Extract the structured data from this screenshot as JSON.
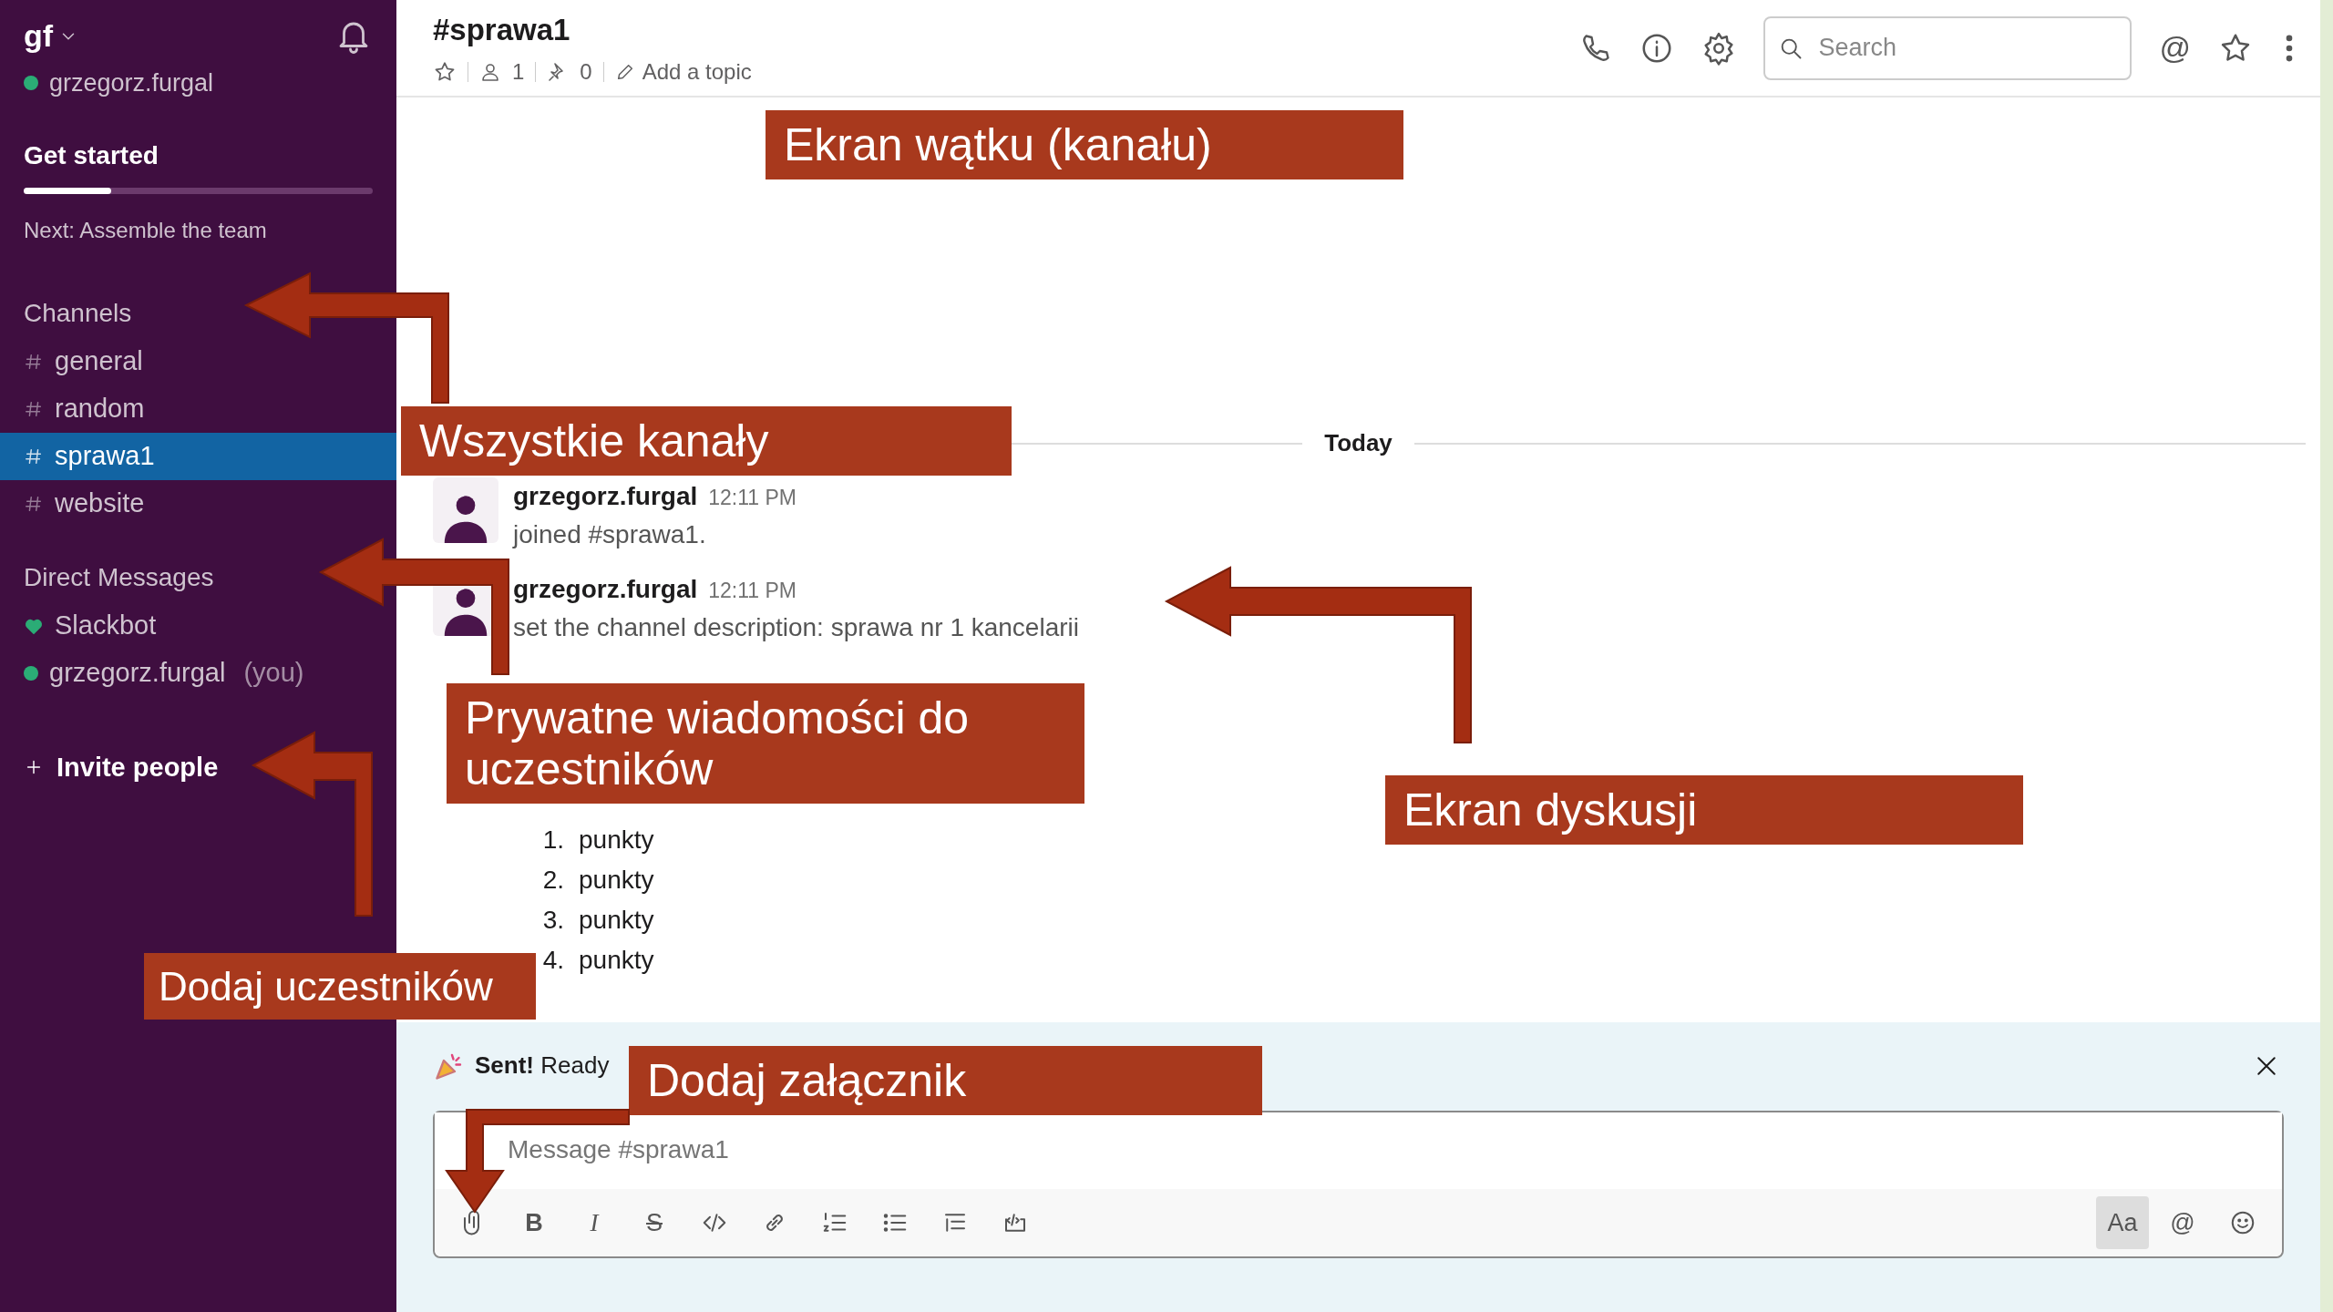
{
  "workspace": {
    "name": "gf",
    "user": "grzegorz.furgal",
    "online": true
  },
  "get_started": {
    "title": "Get started",
    "level": 0.25,
    "next": "Next: Assemble the team"
  },
  "channels": {
    "heading": "Channels",
    "items": [
      {
        "label": "general",
        "selected": false
      },
      {
        "label": "random",
        "selected": false
      },
      {
        "label": "sprawa1",
        "selected": true
      },
      {
        "label": "website",
        "selected": false
      }
    ]
  },
  "direct_messages": {
    "heading": "Direct Messages",
    "items": [
      {
        "kind": "bot",
        "name": "Slackbot"
      },
      {
        "kind": "user",
        "name": "grzegorz.furgal",
        "suffix": "(you)",
        "online": true
      }
    ]
  },
  "invite": {
    "label": "Invite people"
  },
  "channel_header": {
    "title": "#sprawa1",
    "members": "1",
    "pins": "0",
    "topic": "Add a topic"
  },
  "search": {
    "placeholder": "Search"
  },
  "at_label": "@",
  "divider": "Today",
  "messages": [
    {
      "author": "grzegorz.furgal",
      "time": "12:11 PM",
      "text": "joined #sprawa1."
    },
    {
      "author": "grzegorz.furgal",
      "time": "12:11 PM",
      "text": "set the channel description: sprawa nr 1 kancelarii"
    },
    {
      "list": [
        {
          "number": "1.",
          "text": "punkty"
        },
        {
          "number": "2.",
          "text": "punkty"
        },
        {
          "number": "3.",
          "text": "punkty"
        },
        {
          "number": "4.",
          "text": "punkty"
        }
      ]
    }
  ],
  "banner": {
    "text": "**Sent!** Ready"
  },
  "composer": {
    "placeholder": "Message #sprawa1"
  },
  "toolbar": [
    {
      "kind": "attach"
    },
    {
      "kind": "bold",
      "label": "B"
    },
    {
      "kind": "italic",
      "label": "I"
    },
    {
      "kind": "strike",
      "label": "S"
    },
    {
      "kind": "code"
    },
    {
      "kind": "link"
    },
    {
      "kind": "ordered"
    },
    {
      "kind": "bullets"
    },
    {
      "kind": "indent"
    },
    {
      "kind": "codeblock"
    }
  ],
  "toolbar_right": [
    {
      "kind": "format",
      "label": "Aa",
      "selected": true
    },
    {
      "kind": "mention",
      "label": "@"
    },
    {
      "kind": "emoji"
    }
  ],
  "callouts": [
    {
      "text": "Ekran wątku (kanału)"
    },
    {
      "text": "Wszystkie kanały"
    },
    {
      "text": "Prywatne wiadomości do uczestników"
    },
    {
      "text": "Ekran dyskusji"
    },
    {
      "text": "Dodaj uczestników"
    },
    {
      "text": "Dodaj załącznik"
    }
  ]
}
